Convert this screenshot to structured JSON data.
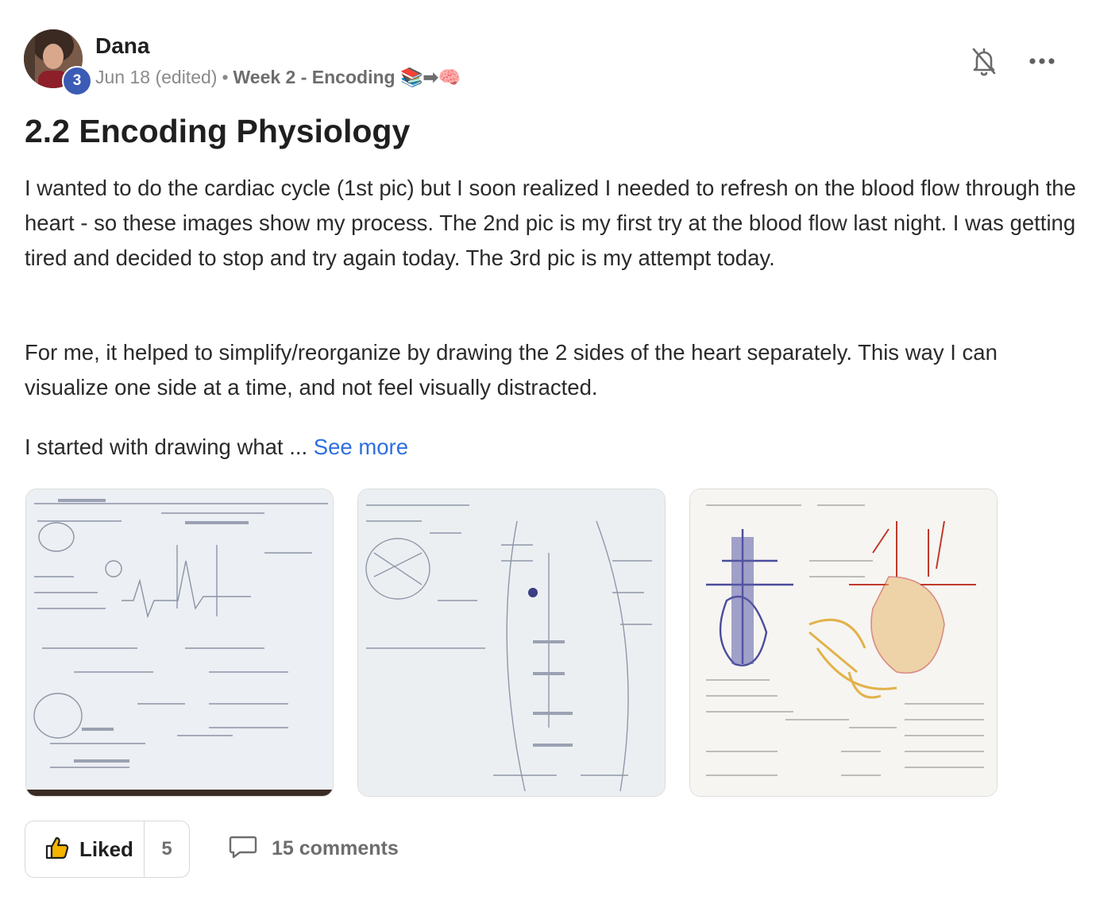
{
  "post": {
    "author": "Dana",
    "level": "3",
    "date": "Jun 18 (edited)",
    "separator": "•",
    "category": "Week 2 - Encoding 📚➡🧠",
    "title": "2.2 Encoding Physiology",
    "body": {
      "p1": "I wanted to do the cardiac cycle (1st pic) but I soon realized I needed to refresh on the blood flow through the heart - so these images show my process. The 2nd pic is my first try at the blood flow last night. I was getting tired and decided to stop and try again today. The 3rd pic is my attempt today.",
      "p2": "For me, it helped to simplify/reorganize by drawing the 2 sides of the heart separately. This way I can visualize one side at a time, and not feel visually distracted.",
      "p3": "I started with drawing what ... ",
      "see_more": "See more"
    },
    "images": [
      {
        "alt": "Cardiac cycle notes drawing"
      },
      {
        "alt": "Blood flow first try drawing"
      },
      {
        "alt": "Blood flow attempt today drawing"
      }
    ]
  },
  "actions": {
    "like_label": "Liked",
    "like_count": "5",
    "comments_label": "15 comments"
  },
  "colors": {
    "accent": "#2f6fe0",
    "level_badge": "#3b5bb5"
  },
  "icons": [
    "bell-off-icon",
    "more-horizontal-icon",
    "thumbs-up-icon",
    "comment-icon"
  ]
}
